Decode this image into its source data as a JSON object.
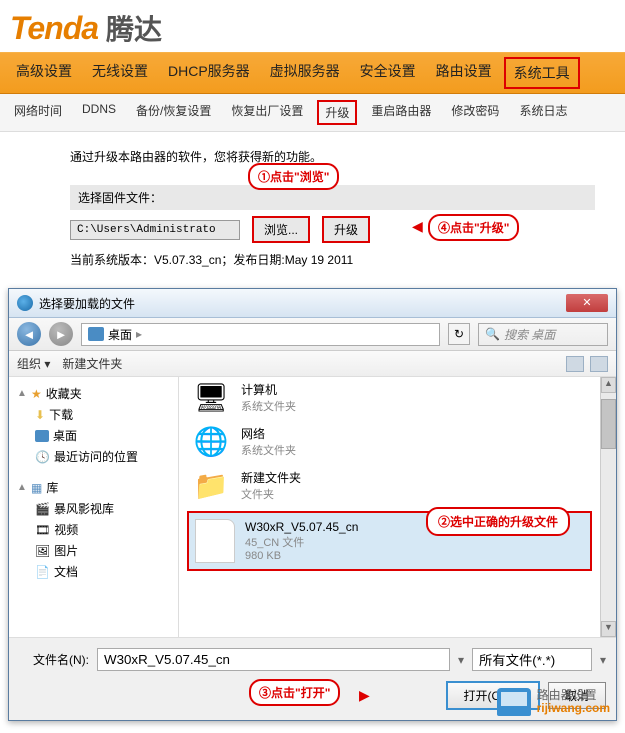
{
  "logo": {
    "brand": "Tenda",
    "cn": "腾达"
  },
  "mainNav": [
    "高级设置",
    "无线设置",
    "DHCP服务器",
    "虚拟服务器",
    "安全设置",
    "路由设置",
    "系统工具"
  ],
  "subNav": [
    "网络时间",
    "DDNS",
    "备份/恢复设置",
    "恢复出厂设置",
    "升级",
    "重启路由器",
    "修改密码",
    "系统日志"
  ],
  "page": {
    "intro": "通过升级本路由器的软件，您将获得新的功能。",
    "selectLabel": "选择固件文件：",
    "filePath": "C:\\Users\\Administrato",
    "browse": "浏览...",
    "upgrade": "升级",
    "version": "当前系统版本：V5.07.33_cn；发布日期:May 19 2011"
  },
  "callouts": {
    "c1": "①点击\"浏览\"",
    "c2": "②选中正确的升级文件",
    "c3": "③点击\"打开\"",
    "c4": "④点击\"升级\""
  },
  "dialog": {
    "title": "选择要加载的文件",
    "location": "桌面",
    "searchPlaceholder": "搜索 桌面",
    "organize": "组织 ▾",
    "newFolder": "新建文件夹",
    "sidebar": {
      "favorites": "收藏夹",
      "downloads": "下载",
      "desktop": "桌面",
      "recent": "最近访问的位置",
      "libraries": "库",
      "storm": "暴风影视库",
      "videos": "视频",
      "pictures": "图片",
      "documents": "文档"
    },
    "files": {
      "systemFolder": "系统文件夹",
      "computer": "计算机",
      "network": "网络",
      "newFolder": "新建文件夹",
      "folderType": "文件夹",
      "selected": {
        "name": "W30xR_V5.07.45_cn",
        "type": "45_CN 文件",
        "size": "980 KB"
      }
    },
    "footer": {
      "fnLabel": "文件名(N):",
      "fnValue": "W30xR_V5.07.45_cn",
      "filter": "所有文件(*.*)",
      "open": "打开(O)",
      "cancel": "取消"
    }
  },
  "watermark": {
    "line1": "路由器设置",
    "line2": "rijiwang.com"
  }
}
